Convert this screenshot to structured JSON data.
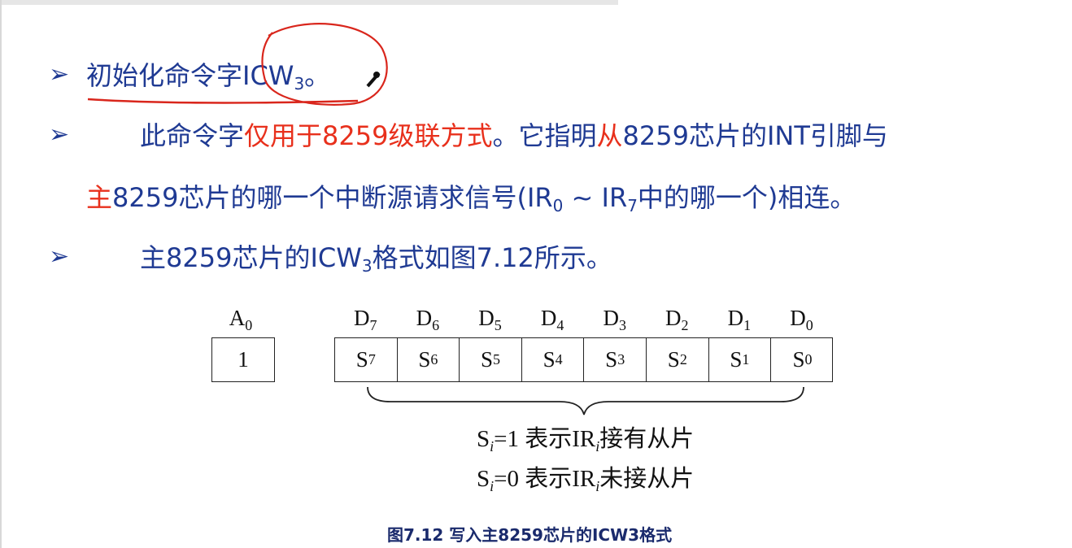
{
  "bullets": [
    {
      "marker": "➢",
      "parts": [
        "初始化命令字ICW",
        "3",
        "。"
      ]
    },
    {
      "marker": "➢",
      "line1": [
        "此命令字",
        "仅用于8259级联方式",
        "。它指明",
        "从",
        "8259芯片的INT引脚与"
      ],
      "line2": [
        "主",
        "8259芯片的哪一个中断源请求信号(IR",
        "0",
        " ~ IR",
        "7",
        "中的哪一个)相连。"
      ]
    },
    {
      "marker": "➢",
      "parts": [
        "主8259芯片的ICW",
        "3",
        "格式如图7.12所示。"
      ]
    }
  ],
  "figure": {
    "a0_header": "A",
    "a0_sub": "0",
    "a0_value": "1",
    "headers": [
      {
        "l": "D",
        "s": "7"
      },
      {
        "l": "D",
        "s": "6"
      },
      {
        "l": "D",
        "s": "5"
      },
      {
        "l": "D",
        "s": "4"
      },
      {
        "l": "D",
        "s": "3"
      },
      {
        "l": "D",
        "s": "2"
      },
      {
        "l": "D",
        "s": "1"
      },
      {
        "l": "D",
        "s": "0"
      }
    ],
    "cells": [
      {
        "l": "S",
        "s": "7"
      },
      {
        "l": "S",
        "s": "6"
      },
      {
        "l": "S",
        "s": "5"
      },
      {
        "l": "S",
        "s": "4"
      },
      {
        "l": "S",
        "s": "3"
      },
      {
        "l": "S",
        "s": "2"
      },
      {
        "l": "S",
        "s": "1"
      },
      {
        "l": "S",
        "s": "0"
      }
    ],
    "legend1": {
      "s": "S",
      "i": "i",
      "eq": "=1 表示IR",
      "i2": "i",
      "tail": "接有从片"
    },
    "legend2": {
      "s": "S",
      "i": "i",
      "eq": "=0 表示IR",
      "i2": "i",
      "tail": "未接从片"
    },
    "caption": "图7.12 写入主8259芯片的ICW3格式"
  },
  "colors": {
    "text": "#1f3a93",
    "highlight": "#e8301c",
    "annotation": "#d9261c"
  }
}
